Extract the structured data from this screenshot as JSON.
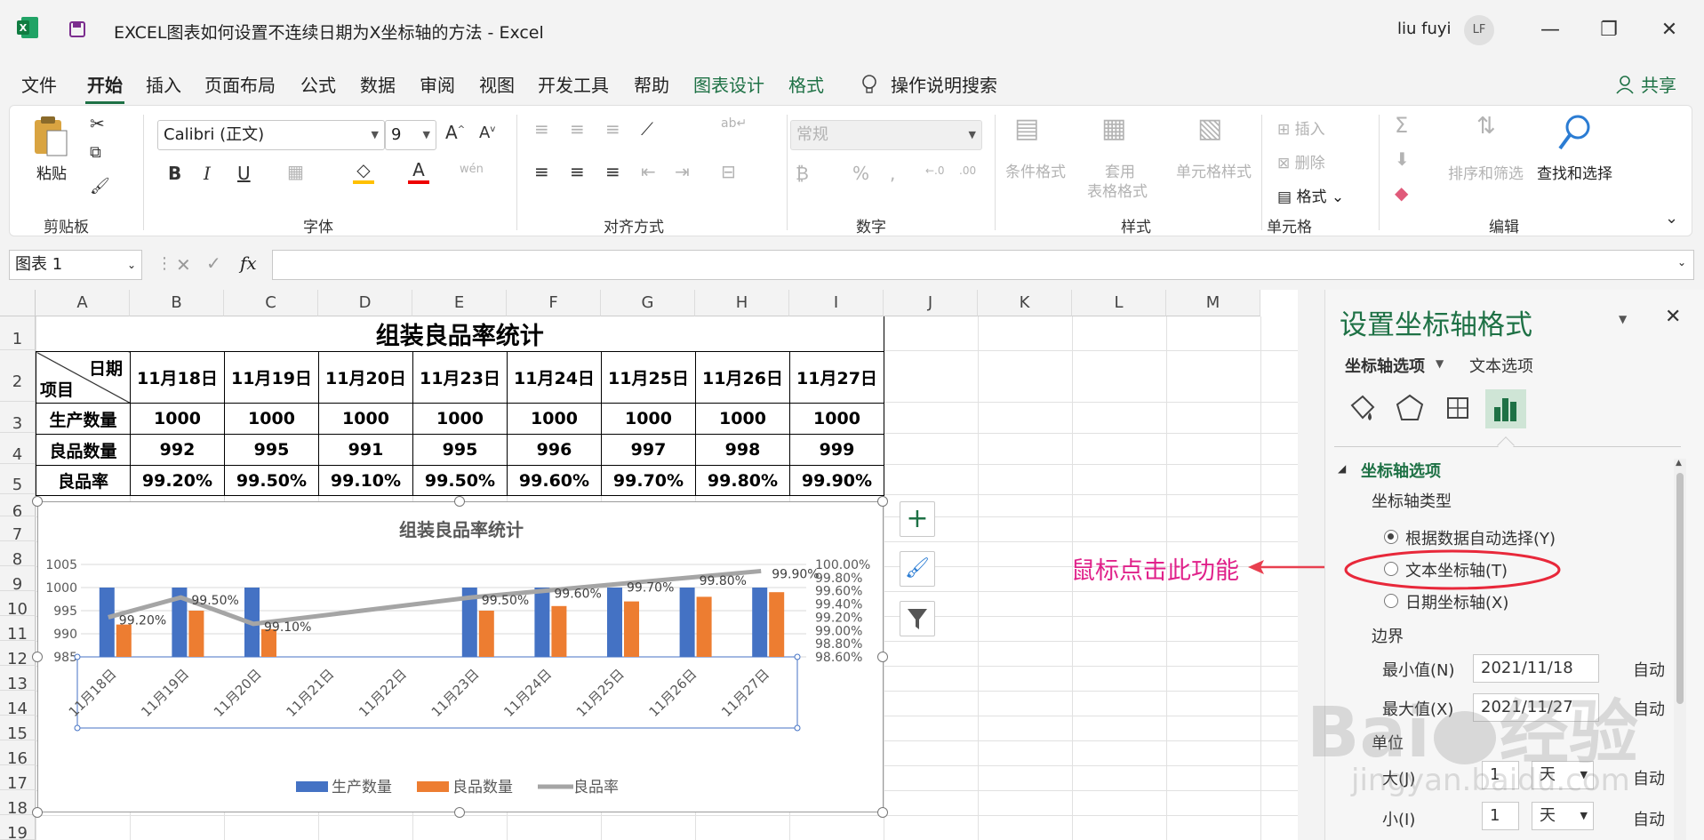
{
  "window": {
    "title": "EXCEL图表如何设置不连续日期为X坐标轴的方法  -  Excel",
    "user_name": "liu fuyi",
    "user_initials": "LF"
  },
  "menu": {
    "tabs": [
      "文件",
      "开始",
      "插入",
      "页面布局",
      "公式",
      "数据",
      "审阅",
      "视图",
      "开发工具",
      "帮助",
      "图表设计",
      "格式"
    ],
    "active_tab": "开始",
    "search_label": "操作说明搜索",
    "share_label": "共享"
  },
  "ribbon": {
    "clipboard": {
      "paste_label": "粘贴",
      "group_label": "剪贴板"
    },
    "font": {
      "font_name": "Calibri (正文)",
      "font_size": "9",
      "group_label": "字体",
      "wen_label": "wén\n文"
    },
    "alignment": {
      "group_label": "对齐方式"
    },
    "number": {
      "format": "常规",
      "group_label": "数字"
    },
    "styles": {
      "conditional": "条件格式",
      "table_line1": "套用",
      "table_line2": "表格格式",
      "cell_styles": "单元格样式",
      "group_label": "样式"
    },
    "cells": {
      "insert": "插入",
      "delete": "删除",
      "format": "格式",
      "group_label": "单元格"
    },
    "editing": {
      "sort_filter": "排序和筛选",
      "find_select": "查找和选择",
      "group_label": "编辑"
    }
  },
  "formula_bar": {
    "name_box": "图表 1",
    "fx": "fx"
  },
  "sheet": {
    "columns": [
      "A",
      "B",
      "C",
      "D",
      "E",
      "F",
      "G",
      "H",
      "I",
      "J",
      "K",
      "L",
      "M"
    ],
    "rows": [
      "1",
      "2",
      "3",
      "4",
      "5",
      "6",
      "7",
      "8",
      "9",
      "10",
      "11",
      "12",
      "13",
      "14",
      "15",
      "16",
      "17",
      "18",
      "19"
    ],
    "table": {
      "title": "组装良品率统计",
      "corner_top": "日期",
      "corner_bottom": "项目",
      "dates": [
        "11月18日",
        "11月19日",
        "11月20日",
        "11月23日",
        "11月24日",
        "11月25日",
        "11月26日",
        "11月27日"
      ],
      "rows": [
        {
          "label": "生产数量",
          "values": [
            "1000",
            "1000",
            "1000",
            "1000",
            "1000",
            "1000",
            "1000",
            "1000"
          ]
        },
        {
          "label": "良品数量",
          "values": [
            "992",
            "995",
            "991",
            "995",
            "996",
            "997",
            "998",
            "999"
          ]
        },
        {
          "label": "良品率",
          "values": [
            "99.20%",
            "99.50%",
            "99.10%",
            "99.50%",
            "99.60%",
            "99.70%",
            "99.80%",
            "99.90%"
          ]
        }
      ]
    }
  },
  "chart_data": {
    "type": "bar",
    "title": "组装良品率统计",
    "categories": [
      "11月18日",
      "11月19日",
      "11月20日",
      "11月21日",
      "11月22日",
      "11月23日",
      "11月24日",
      "11月25日",
      "11月26日",
      "11月27日"
    ],
    "series": [
      {
        "name": "生产数量",
        "type": "bar",
        "axis": "left",
        "color": "#4472c4",
        "values": [
          1000,
          1000,
          1000,
          null,
          null,
          1000,
          1000,
          1000,
          1000,
          1000
        ]
      },
      {
        "name": "良品数量",
        "type": "bar",
        "axis": "left",
        "color": "#ed7d31",
        "values": [
          992,
          995,
          991,
          null,
          null,
          995,
          996,
          997,
          998,
          999
        ]
      },
      {
        "name": "良品率",
        "type": "line",
        "axis": "right",
        "color": "#a5a5a5",
        "values": [
          99.2,
          99.5,
          99.1,
          null,
          null,
          99.5,
          99.6,
          99.7,
          99.8,
          99.9
        ],
        "labels": [
          "99.20%",
          "99.50%",
          "99.10%",
          "",
          "",
          "99.50%",
          "99.60%",
          "99.70%",
          "99.80%",
          "99.90%"
        ]
      }
    ],
    "y_left": {
      "ylim": [
        985,
        1005
      ],
      "ticks": [
        "1005",
        "1000",
        "995",
        "990",
        "985"
      ]
    },
    "y_right": {
      "ylim": [
        98.6,
        100.0
      ],
      "ticks": [
        "100.00%",
        "99.80%",
        "99.60%",
        "99.40%",
        "99.20%",
        "99.00%",
        "98.80%",
        "98.60%"
      ]
    },
    "legend": "bottom",
    "grid": true
  },
  "panel": {
    "title": "设置坐标轴格式",
    "tab_axis": "坐标轴选项",
    "tab_text": "文本选项",
    "section": "坐标轴选项",
    "axis_type_label": "坐标轴类型",
    "axis_types": [
      "根据数据自动选择(Y)",
      "文本坐标轴(T)",
      "日期坐标轴(X)"
    ],
    "selected_axis_type": 0,
    "bounds_label": "边界",
    "min_label": "最小值(N)",
    "min_value": "2021/11/18",
    "max_label": "最大值(X)",
    "max_value": "2021/11/27",
    "auto_label": "自动",
    "units_label": "单位",
    "major_label": "大(J)",
    "major_value": "1",
    "major_unit": "天",
    "minor_label": "小(I)",
    "minor_value": "1",
    "minor_unit": "天"
  },
  "annotation": "鼠标点击此功能",
  "watermark": {
    "main": "Bai",
    "sub": "经验",
    "url": "jingyan.baidu.com"
  }
}
